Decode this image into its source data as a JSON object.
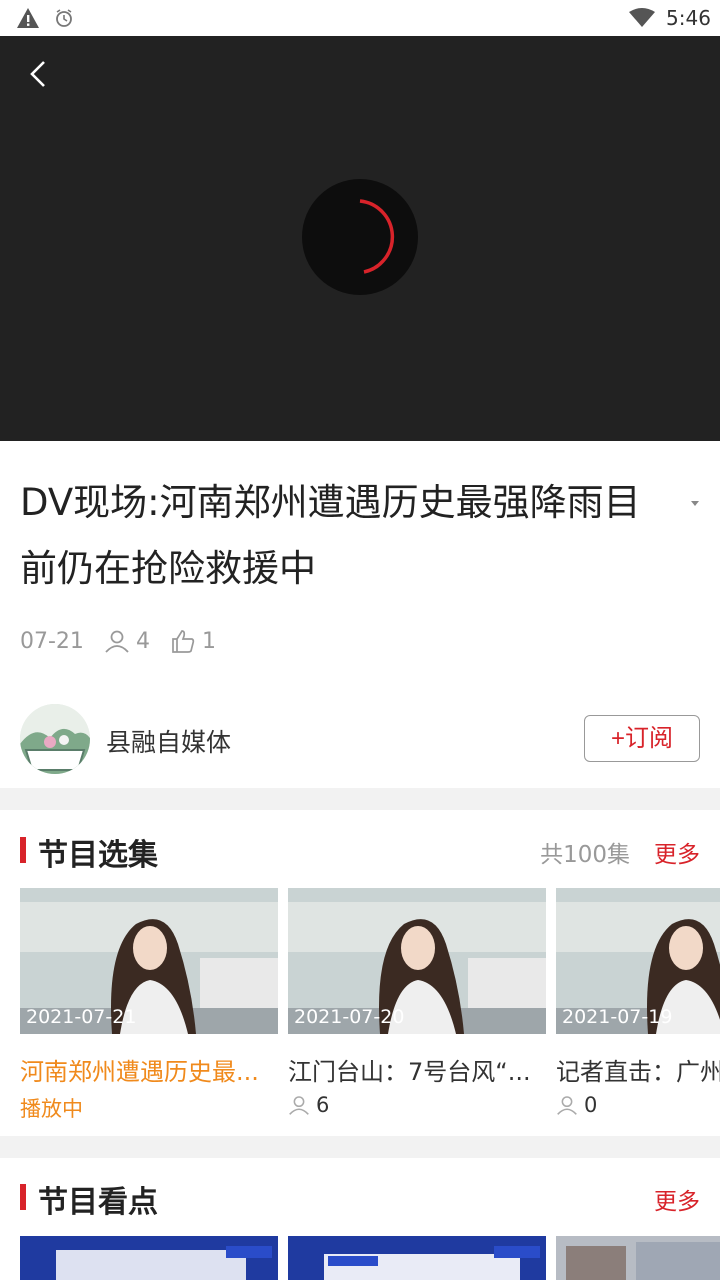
{
  "status_bar": {
    "time": "5:46",
    "icons": [
      "warning-icon",
      "alarm-icon",
      "wifi-icon"
    ]
  },
  "player": {
    "back_icon": "back-arrow-icon",
    "loading_icon": "loading-spinner-icon",
    "accent": "#d8232a"
  },
  "video": {
    "title": "DV现场:河南郑州遭遇历史最强降雨目前仍在抢险救援中",
    "date": "07-21",
    "views": "4",
    "likes": "1"
  },
  "author": {
    "name": "县融自媒体",
    "subscribe_label": "+订阅"
  },
  "episodes_section": {
    "title": "节目选集",
    "count": "共100集",
    "more": "更多",
    "items": [
      {
        "date": "2021-07-21",
        "title": "河南郑州遭遇历史最...",
        "status": "播放中"
      },
      {
        "date": "2021-07-20",
        "title": "江门台山：7号台风“...",
        "views": "6"
      },
      {
        "date": "2021-07-19",
        "title": "记者直击：广州",
        "views": "0"
      }
    ]
  },
  "highlights_section": {
    "title": "节目看点",
    "more": "更多"
  },
  "colors": {
    "accent": "#d8232a",
    "playing": "#f08a1c",
    "player_bg": "#222222"
  }
}
